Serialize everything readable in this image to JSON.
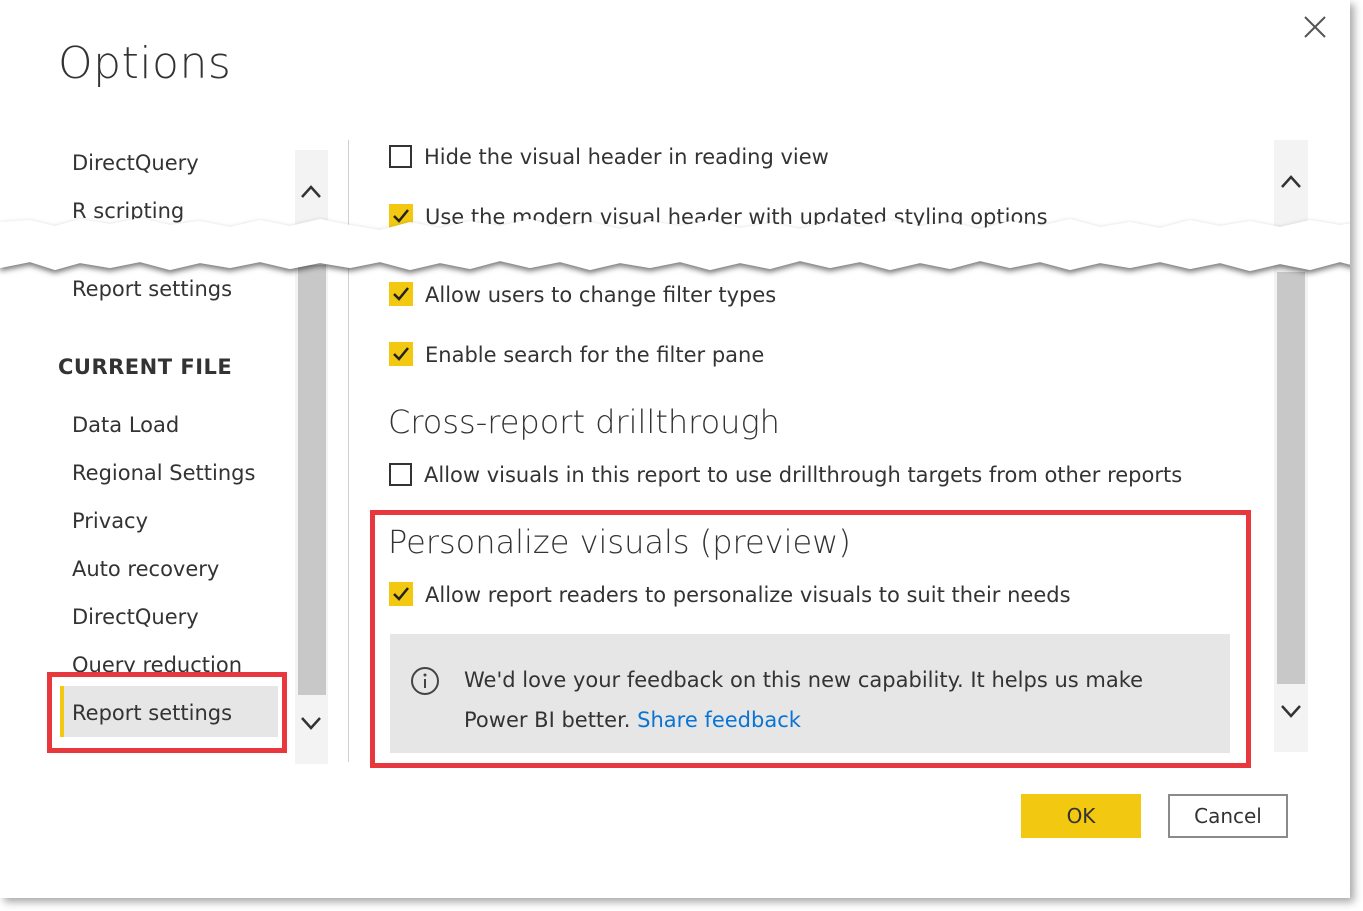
{
  "dialog": {
    "title": "Options",
    "close_icon": "close-icon"
  },
  "nav": {
    "top_items": [
      "DirectQuery",
      "R scripting"
    ],
    "report_settings_global": "Report settings",
    "section_current_file": "CURRENT FILE",
    "current_file_items": [
      "Data Load",
      "Regional Settings",
      "Privacy",
      "Auto recovery",
      "DirectQuery",
      "Query reduction"
    ],
    "selected_item": "Report settings"
  },
  "options": {
    "hide_visual_header": {
      "label": "Hide the visual header in reading view",
      "checked": false
    },
    "modern_visual_header": {
      "label": "Use the modern visual header with updated styling options",
      "checked": true
    },
    "change_filter_types": {
      "label": "Allow users to change filter types",
      "checked": true
    },
    "filter_pane_search": {
      "label": "Enable search for the filter pane",
      "checked": true
    },
    "cross_report_heading": "Cross-report drillthrough",
    "cross_report_drillthrough": {
      "label": "Allow visuals in this report to use drillthrough targets from other reports",
      "checked": false
    },
    "personalize_heading": "Personalize visuals (preview)",
    "personalize_visuals": {
      "label": "Allow report readers to personalize visuals to suit their needs",
      "checked": true
    }
  },
  "info": {
    "icon": "info-icon",
    "text": "We'd love your feedback on this new capability. It helps us make Power BI better.",
    "link": "Share feedback"
  },
  "buttons": {
    "ok": "OK",
    "cancel": "Cancel"
  },
  "colors": {
    "accent": "#f2c811",
    "highlight": "#e8383d",
    "link": "#0a74d4"
  }
}
